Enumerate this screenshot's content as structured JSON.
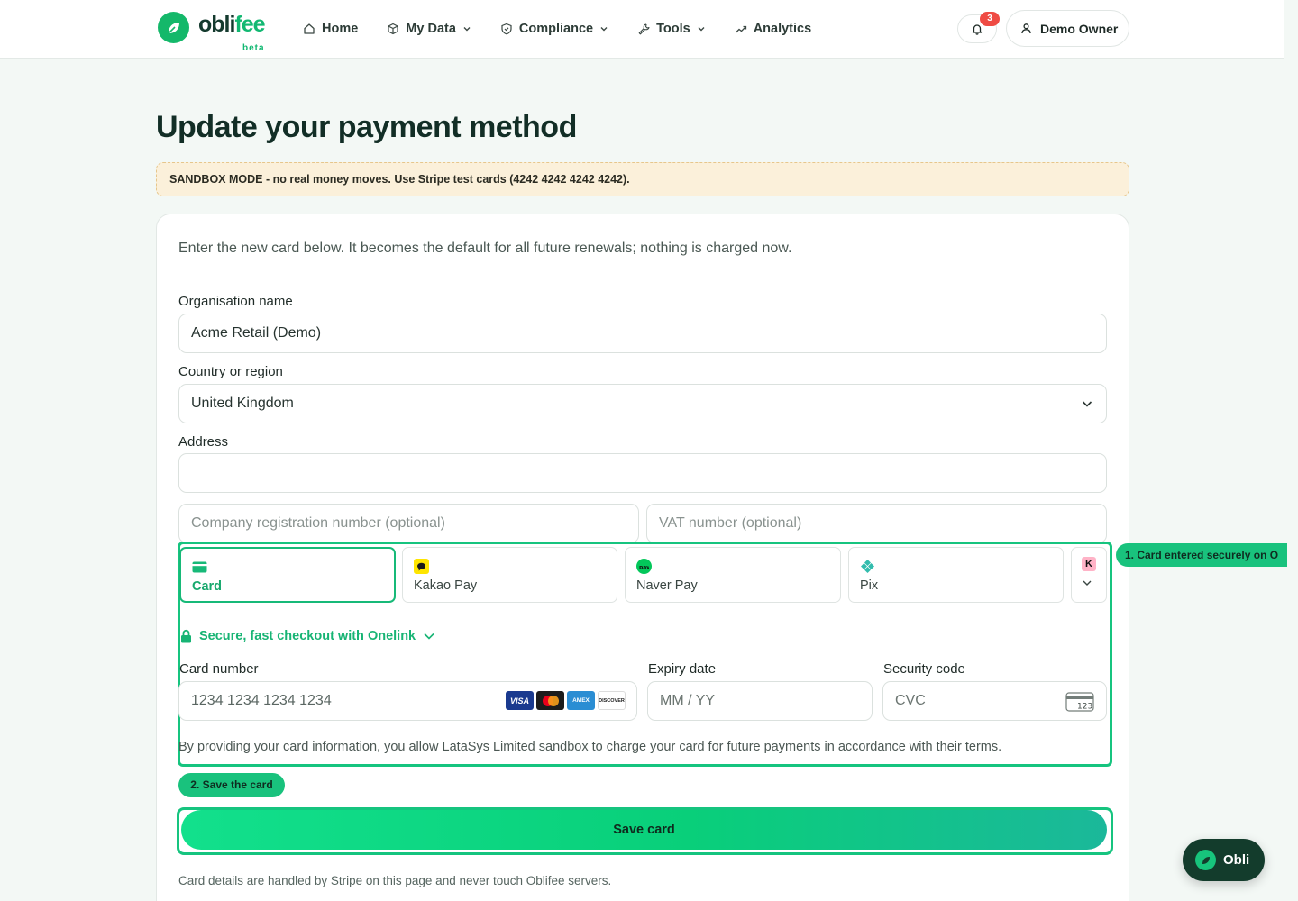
{
  "brand": {
    "name_a": "obli",
    "name_b": "fee",
    "beta": "beta"
  },
  "nav": [
    {
      "label": "Home",
      "icon": "home-icon",
      "dropdown": false
    },
    {
      "label": "My Data",
      "icon": "cube-icon",
      "dropdown": true
    },
    {
      "label": "Compliance",
      "icon": "shield-icon",
      "dropdown": true
    },
    {
      "label": "Tools",
      "icon": "wrench-icon",
      "dropdown": true
    },
    {
      "label": "Analytics",
      "icon": "trend-icon",
      "dropdown": false
    }
  ],
  "notifications": {
    "count": "3"
  },
  "user": {
    "label": "Demo Owner"
  },
  "page": {
    "title": "Update your payment method",
    "sandbox_notice": "SANDBOX MODE - no real money moves. Use Stripe test cards (4242 4242 4242 4242).",
    "intro": "Enter the new card below. It becomes the default for all future renewals; nothing is charged now."
  },
  "form": {
    "org_label": "Organisation name",
    "org_value": "Acme Retail (Demo)",
    "country_label": "Country or region",
    "country_value": "United Kingdom",
    "address_label": "Address",
    "address_value": "",
    "company_reg_placeholder": "Company registration number (optional)",
    "vat_placeholder": "VAT number (optional)"
  },
  "payment_methods": [
    {
      "label": "Card",
      "icon": "card-icon",
      "color": "#17b978",
      "active": true
    },
    {
      "label": "Kakao Pay",
      "icon": "kakao-icon",
      "color": "#fee500",
      "active": false
    },
    {
      "label": "Naver Pay",
      "icon": "naver-icon",
      "color": "#03c75a",
      "active": false
    },
    {
      "label": "Pix",
      "icon": "pix-icon",
      "color": "#32bcad",
      "active": false
    }
  ],
  "more_methods": {
    "icon": "klarna-icon",
    "letter": "K"
  },
  "onelink": "Secure, fast checkout with Onelink",
  "card": {
    "number_label": "Card number",
    "number_placeholder": "1234 1234 1234 1234",
    "expiry_label": "Expiry date",
    "expiry_placeholder": "MM / YY",
    "cvc_label": "Security code",
    "cvc_placeholder": "CVC",
    "cvc_icon_text": "123",
    "brands": [
      "VISA",
      "mastercard",
      "AMEX",
      "DISCOVER"
    ]
  },
  "terms": "By providing your card information, you allow LataSys Limited sandbox to charge your card for future payments in accordance with their terms.",
  "callouts": {
    "step1": "1. Card entered securely on O",
    "step2": "2. Save the card"
  },
  "save_button": "Save card",
  "footnote": "Card details are handled by Stripe on this page and never touch Oblifee servers.",
  "assistant": {
    "label": "Obli"
  },
  "colors": {
    "accent": "#17b978",
    "dark": "#133c2c",
    "warning_bg": "#fbf0da",
    "badge": "#ef4b44"
  }
}
